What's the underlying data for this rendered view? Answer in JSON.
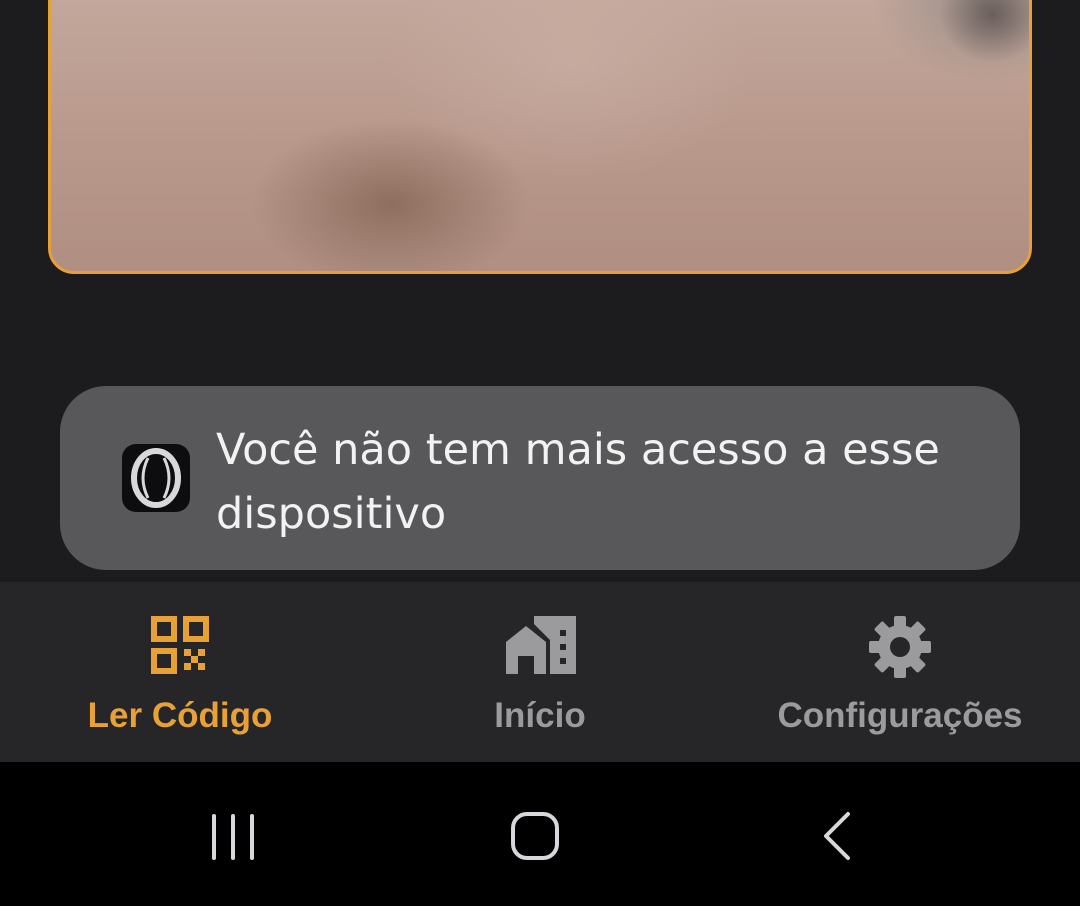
{
  "colors": {
    "accent": "#e8a136",
    "toast_background": "#58585a",
    "nav_background": "#262628",
    "inactive": "#9b9b9d"
  },
  "toast": {
    "icon": "app-logo-icon",
    "message": "Você não tem mais acesso a esse dispositivo"
  },
  "bottom_nav": {
    "items": [
      {
        "label": "Ler Código",
        "icon": "qr-code-icon",
        "active": true
      },
      {
        "label": "Início",
        "icon": "home-building-icon",
        "active": false
      },
      {
        "label": "Configurações",
        "icon": "gear-icon",
        "active": false
      }
    ]
  },
  "system_nav": {
    "buttons": [
      "recent-apps-icon",
      "home-icon",
      "back-icon"
    ]
  }
}
